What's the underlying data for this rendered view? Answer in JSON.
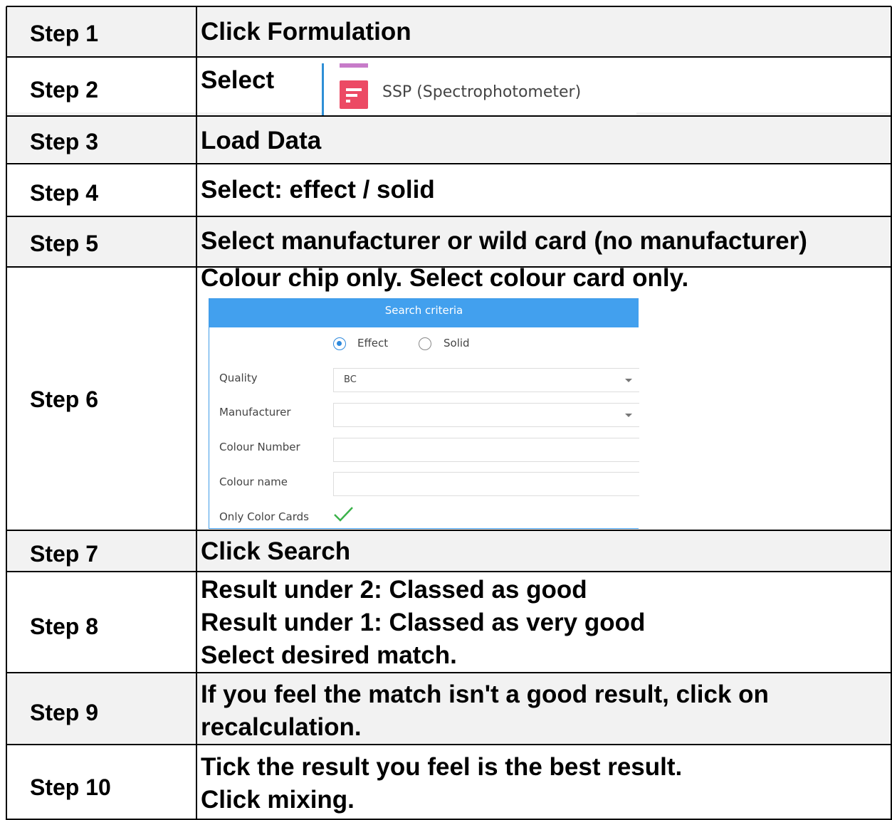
{
  "rows": [
    {
      "label": "Step 1",
      "lines": [
        "Click Formulation"
      ]
    },
    {
      "label": "Step 2",
      "lines": [
        "Select"
      ]
    },
    {
      "label": "Step 3",
      "lines": [
        "Load Data"
      ]
    },
    {
      "label": "Step 4",
      "lines": [
        "Select: effect / solid"
      ]
    },
    {
      "label": "Step 5",
      "lines": [
        "Select manufacturer or wild card (no manufacturer)"
      ]
    },
    {
      "label": "Step 6",
      "lines": [
        "Colour chip only. Select colour card only."
      ]
    },
    {
      "label": "Step 7",
      "lines": [
        "Click Search"
      ]
    },
    {
      "label": "Step 8",
      "lines": [
        "Result under 2: Classed as good",
        "Result under 1: Classed as very good",
        "Select desired match."
      ]
    },
    {
      "label": "Step 9",
      "lines": [
        "If you feel the match isn't a good result, click on",
        "recalculation."
      ]
    },
    {
      "label": "Step 10",
      "lines": [
        "Tick the result you feel is the best result.",
        "Click mixing."
      ]
    }
  ],
  "menu": {
    "item_label": "SSP (Spectrophotometer)",
    "icon": "report-list-icon"
  },
  "search_panel": {
    "title": "Search criteria",
    "radio_effect": "Effect",
    "radio_solid": "Solid",
    "selected_type": "Effect",
    "quality_label": "Quality",
    "quality_value": "BC",
    "manufacturer_label": "Manufacturer",
    "manufacturer_value": "",
    "colour_number_label": "Colour Number",
    "colour_name_label": "Colour name",
    "only_color_cards_label": "Only Color Cards",
    "only_color_cards_checked": true,
    "accent_color": "#42a0ee",
    "check_color": "#3bb24a"
  }
}
